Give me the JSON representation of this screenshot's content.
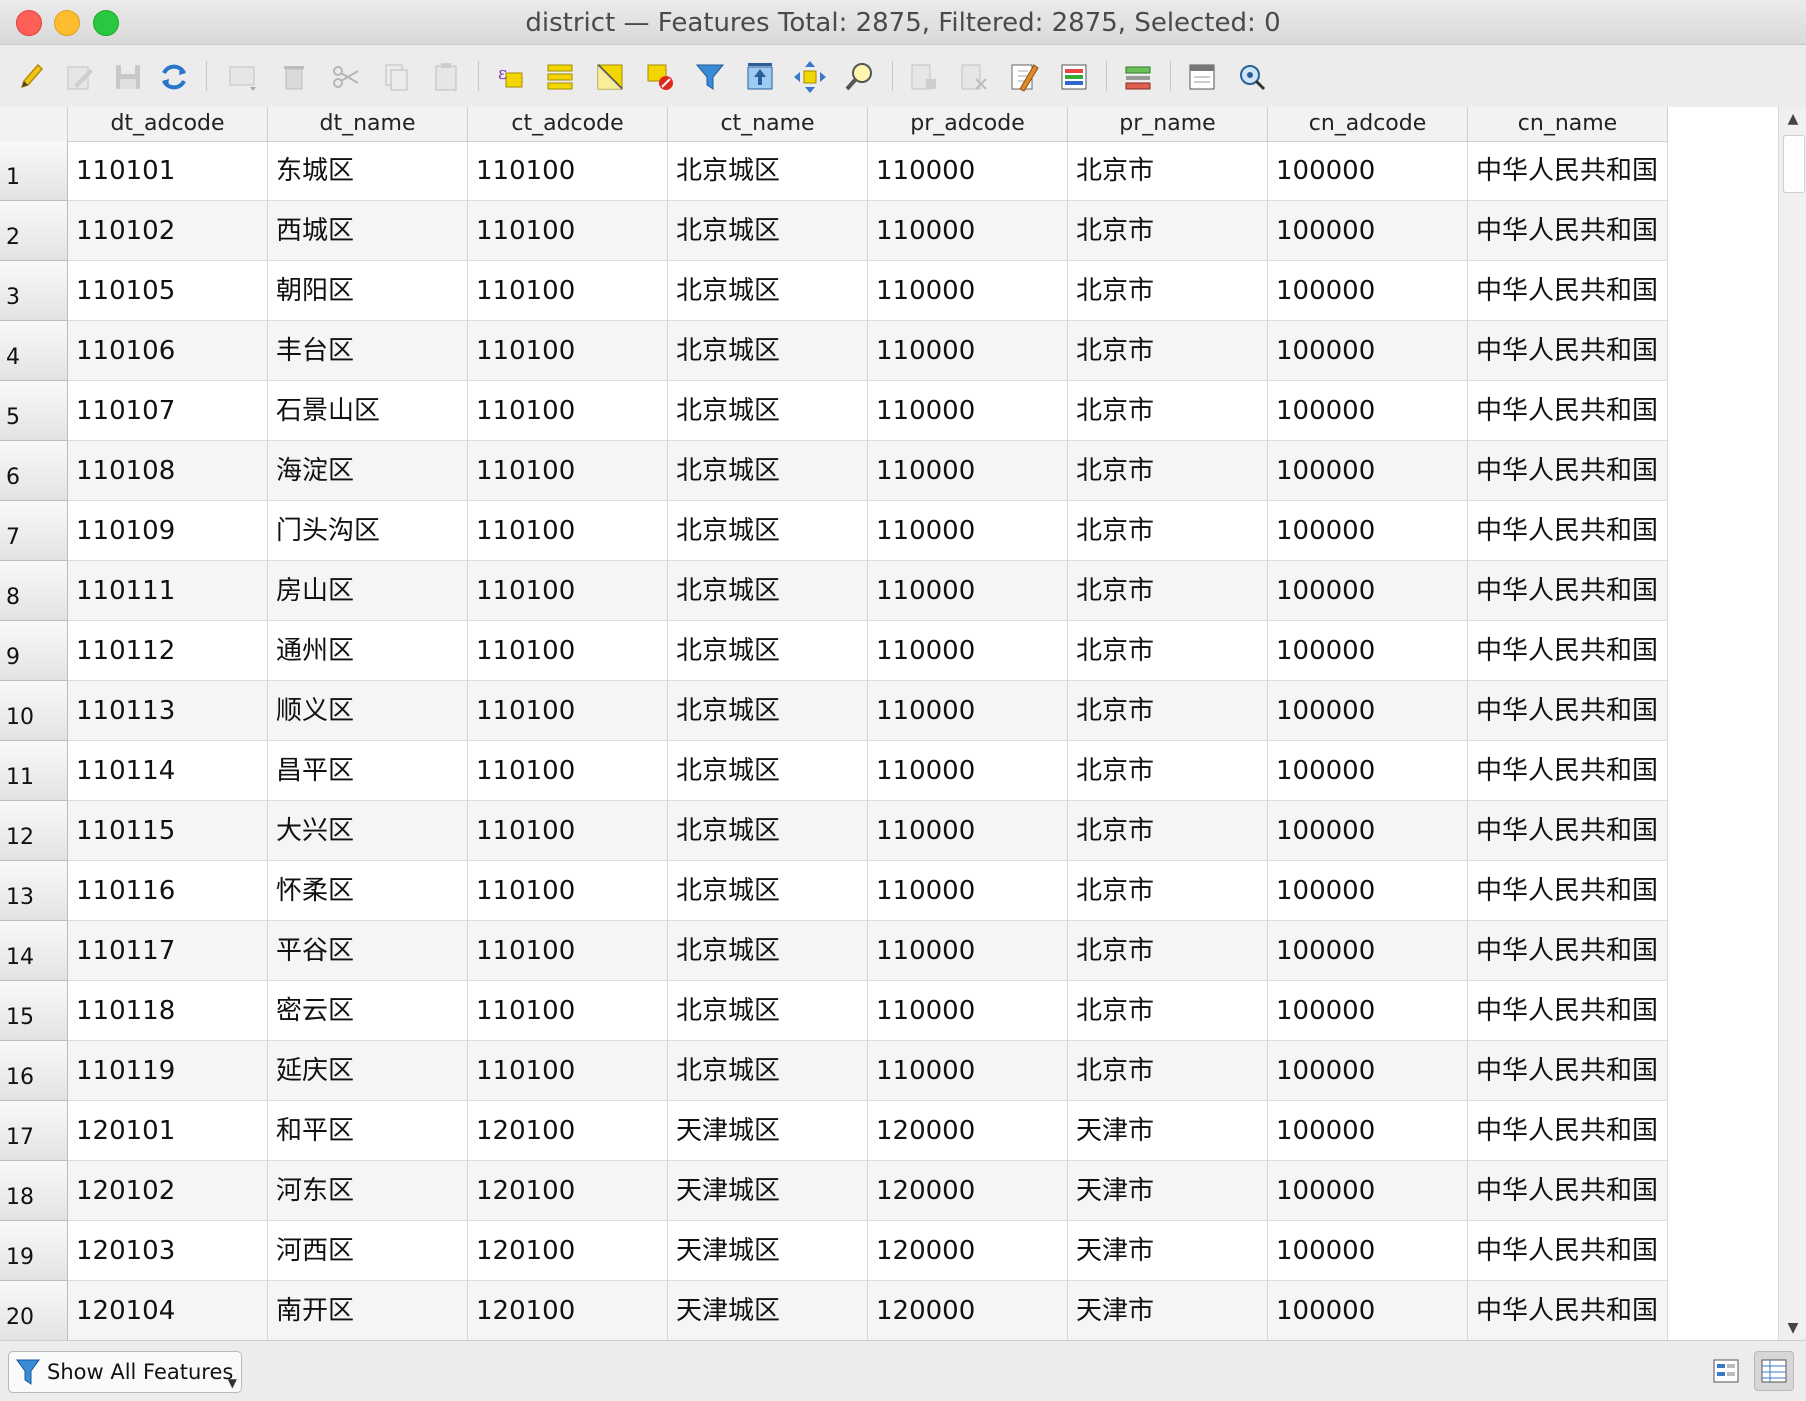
{
  "window": {
    "title": "district — Features Total: 2875, Filtered: 2875, Selected: 0"
  },
  "toolbar": {
    "buttons": [
      "toggle-editing-icon",
      "toggle-multi-edit-icon",
      "save-edits-icon",
      "reload-table-icon",
      "add-feature-icon",
      "delete-features-icon",
      "cut-icon",
      "copy-icon",
      "paste-icon",
      "select-by-expression-icon",
      "select-all-icon",
      "invert-selection-icon",
      "deselect-all-icon",
      "filter-select-icon",
      "move-selection-to-top-icon",
      "pan-to-selected-icon",
      "zoom-to-selected-icon",
      "new-field-icon",
      "delete-field-icon",
      "field-calculator-icon",
      "conditional-formatting-icon",
      "dock-table-icon",
      "actions-icon"
    ]
  },
  "table": {
    "columns": [
      "dt_adcode",
      "dt_name",
      "ct_adcode",
      "ct_name",
      "pr_adcode",
      "pr_name",
      "cn_adcode",
      "cn_name"
    ],
    "rows": [
      {
        "n": "1",
        "c": [
          "110101",
          "东城区",
          "110100",
          "北京城区",
          "110000",
          "北京市",
          "100000",
          "中华人民共和国"
        ]
      },
      {
        "n": "2",
        "c": [
          "110102",
          "西城区",
          "110100",
          "北京城区",
          "110000",
          "北京市",
          "100000",
          "中华人民共和国"
        ]
      },
      {
        "n": "3",
        "c": [
          "110105",
          "朝阳区",
          "110100",
          "北京城区",
          "110000",
          "北京市",
          "100000",
          "中华人民共和国"
        ]
      },
      {
        "n": "4",
        "c": [
          "110106",
          "丰台区",
          "110100",
          "北京城区",
          "110000",
          "北京市",
          "100000",
          "中华人民共和国"
        ]
      },
      {
        "n": "5",
        "c": [
          "110107",
          "石景山区",
          "110100",
          "北京城区",
          "110000",
          "北京市",
          "100000",
          "中华人民共和国"
        ]
      },
      {
        "n": "6",
        "c": [
          "110108",
          "海淀区",
          "110100",
          "北京城区",
          "110000",
          "北京市",
          "100000",
          "中华人民共和国"
        ]
      },
      {
        "n": "7",
        "c": [
          "110109",
          "门头沟区",
          "110100",
          "北京城区",
          "110000",
          "北京市",
          "100000",
          "中华人民共和国"
        ]
      },
      {
        "n": "8",
        "c": [
          "110111",
          "房山区",
          "110100",
          "北京城区",
          "110000",
          "北京市",
          "100000",
          "中华人民共和国"
        ]
      },
      {
        "n": "9",
        "c": [
          "110112",
          "通州区",
          "110100",
          "北京城区",
          "110000",
          "北京市",
          "100000",
          "中华人民共和国"
        ]
      },
      {
        "n": "10",
        "c": [
          "110113",
          "顺义区",
          "110100",
          "北京城区",
          "110000",
          "北京市",
          "100000",
          "中华人民共和国"
        ]
      },
      {
        "n": "11",
        "c": [
          "110114",
          "昌平区",
          "110100",
          "北京城区",
          "110000",
          "北京市",
          "100000",
          "中华人民共和国"
        ]
      },
      {
        "n": "12",
        "c": [
          "110115",
          "大兴区",
          "110100",
          "北京城区",
          "110000",
          "北京市",
          "100000",
          "中华人民共和国"
        ]
      },
      {
        "n": "13",
        "c": [
          "110116",
          "怀柔区",
          "110100",
          "北京城区",
          "110000",
          "北京市",
          "100000",
          "中华人民共和国"
        ]
      },
      {
        "n": "14",
        "c": [
          "110117",
          "平谷区",
          "110100",
          "北京城区",
          "110000",
          "北京市",
          "100000",
          "中华人民共和国"
        ]
      },
      {
        "n": "15",
        "c": [
          "110118",
          "密云区",
          "110100",
          "北京城区",
          "110000",
          "北京市",
          "100000",
          "中华人民共和国"
        ]
      },
      {
        "n": "16",
        "c": [
          "110119",
          "延庆区",
          "110100",
          "北京城区",
          "110000",
          "北京市",
          "100000",
          "中华人民共和国"
        ]
      },
      {
        "n": "17",
        "c": [
          "120101",
          "和平区",
          "120100",
          "天津城区",
          "120000",
          "天津市",
          "100000",
          "中华人民共和国"
        ]
      },
      {
        "n": "18",
        "c": [
          "120102",
          "河东区",
          "120100",
          "天津城区",
          "120000",
          "天津市",
          "100000",
          "中华人民共和国"
        ]
      },
      {
        "n": "19",
        "c": [
          "120103",
          "河西区",
          "120100",
          "天津城区",
          "120000",
          "天津市",
          "100000",
          "中华人民共和国"
        ]
      },
      {
        "n": "20",
        "c": [
          "120104",
          "南开区",
          "120100",
          "天津城区",
          "120000",
          "天津市",
          "100000",
          "中华人民共和国"
        ]
      }
    ]
  },
  "bottom": {
    "filter_label": "Show All Features",
    "filter_icon": "funnel-icon",
    "views": [
      "form-view-icon",
      "table-view-icon"
    ]
  }
}
